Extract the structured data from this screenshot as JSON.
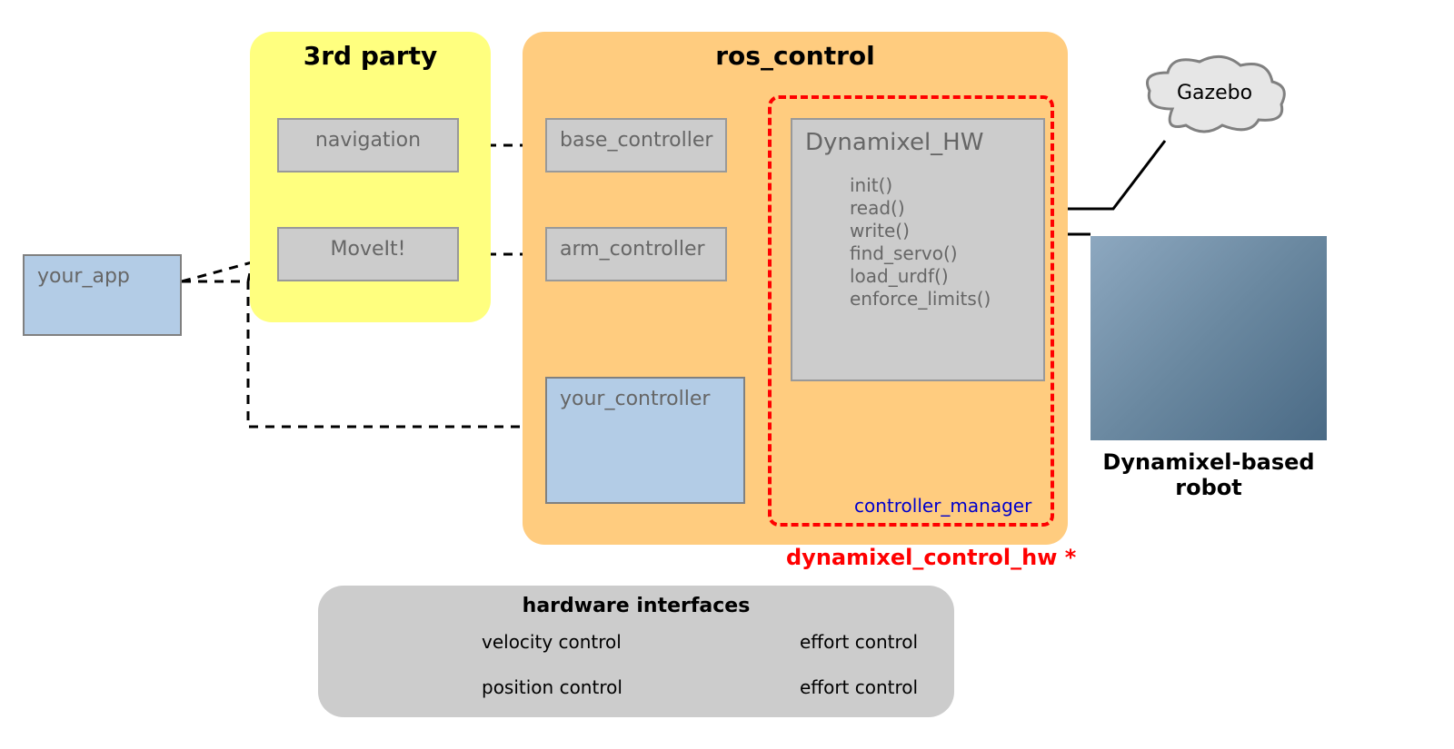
{
  "nodes": {
    "your_app": "your_app",
    "navigation": "navigation",
    "moveit": "MoveIt!",
    "base_controller": "base_controller",
    "arm_controller": "arm_controller",
    "your_controller": "your_controller",
    "dynamixel_hw": "Dynamixel_HW",
    "gazebo": "Gazebo"
  },
  "titles": {
    "third_party": "3rd party",
    "ros_control": "ros_control",
    "robot": "Dynamixel-based robot"
  },
  "methods": [
    "init()",
    "read()",
    "write()",
    "find_servo()",
    "load_urdf()",
    "enforce_limits()"
  ],
  "labels": {
    "controller_manager": "controller_manager",
    "dynamixel_control_hw": "dynamixel_control_hw *"
  },
  "legend": {
    "title": "hardware interfaces",
    "velocity": "velocity control",
    "position": "position control",
    "effort_diamond": "effort control",
    "effort_star": "effort control"
  }
}
